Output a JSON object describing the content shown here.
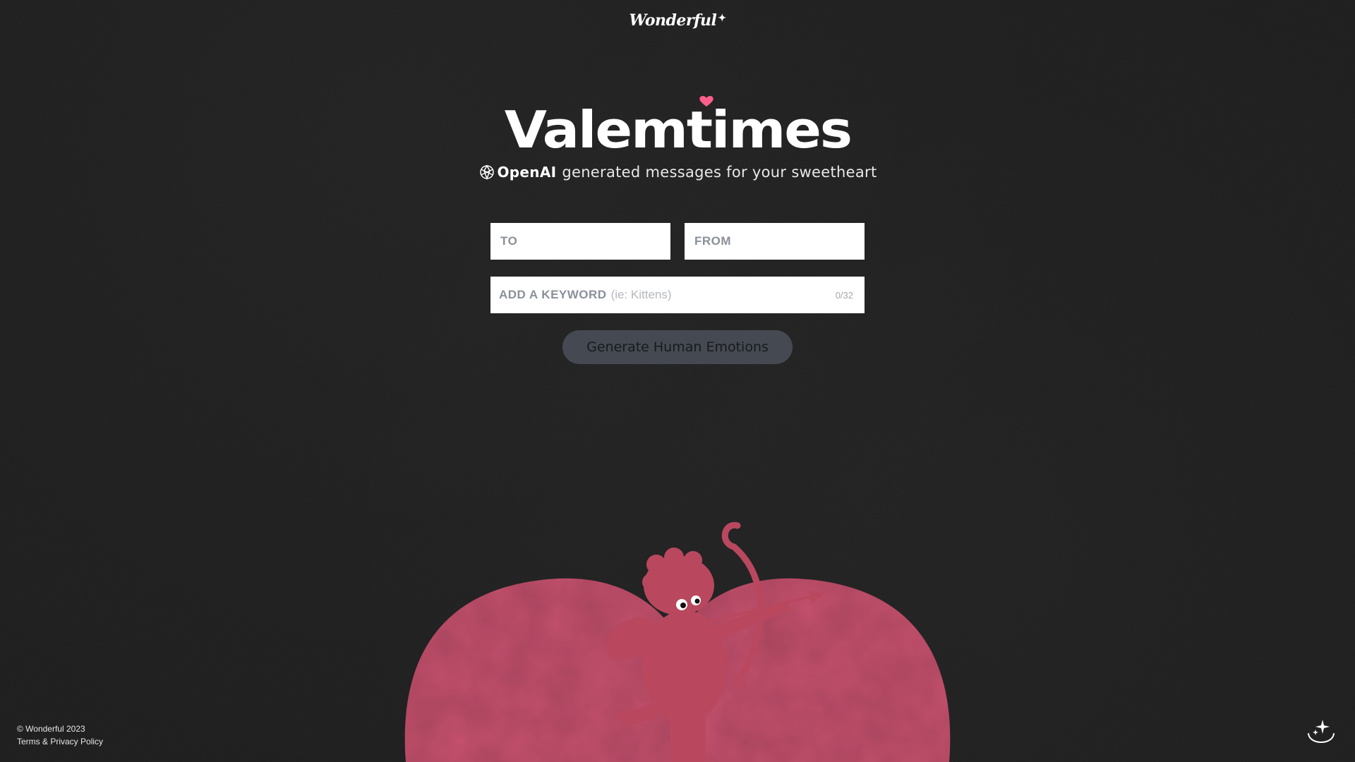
{
  "brand": {
    "name": "Wonderful",
    "spark": "✦"
  },
  "hero": {
    "title": "Valemtimes",
    "badge": "OpenAI",
    "subtitle": "generated messages for your sweetheart"
  },
  "form": {
    "to_placeholder": "TO",
    "from_placeholder": "FROM",
    "keyword_label": "ADD A KEYWORD",
    "keyword_hint": "(ie: Kittens)",
    "keyword_counter": "0/32",
    "generate_label": "Generate Human Emotions"
  },
  "footer": {
    "copyright": "© Wonderful 2023",
    "terms": "Terms & Privacy Policy"
  },
  "colors": {
    "background": "#1a1a1a",
    "heart_pink": "#c4506d",
    "accent_heart": "#ff5f8a",
    "button": "#454a52"
  },
  "icons": {
    "openai": "openai-logo-icon",
    "corner": "sparkle-smile-icon"
  }
}
